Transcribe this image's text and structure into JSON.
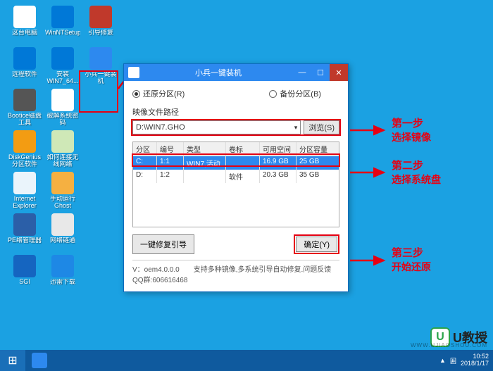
{
  "desktop_icons": {
    "col1": [
      {
        "label": "这台电脑",
        "style": "background:#fff;"
      },
      {
        "label": "远程软件",
        "style": "background:#0078d7;color:#fff;"
      },
      {
        "label": "Bootice磁盘工具",
        "style": "background:#555;"
      },
      {
        "label": "DiskGenius分区软件",
        "style": "background:#f39c12;"
      },
      {
        "label": "Internet Explorer",
        "style": "background:#eaf4fb;color:#1e6db1;"
      },
      {
        "label": "PE络管理器",
        "style": "background:#2b5fa8;"
      },
      {
        "label": "SGI",
        "style": "background:#1565c0;color:#fff;"
      }
    ],
    "col2": [
      {
        "label": "WinNTSetup",
        "style": "background:#0078d7;"
      },
      {
        "label": "安装WIN7_64...",
        "style": "background:#0078d7;color:#fff;"
      },
      {
        "label": "破解系统密码",
        "style": "background:#fff;color:#d00;"
      },
      {
        "label": "如何连接无线网络",
        "style": "background:#cfe8b7;"
      },
      {
        "label": "手动运行Ghost",
        "style": "background:#f5b041;"
      },
      {
        "label": "网络链通",
        "style": "background:#e8e8e8;"
      },
      {
        "label": "迅雷下载",
        "style": "background:#1e88e5;color:#fff;"
      }
    ],
    "col3": [
      {
        "label": "引导修复",
        "style": "background:#c0392b;color:#fff;"
      },
      {
        "label": "小兵一键装机",
        "style": "background:#2d89ef;color:#fff;"
      }
    ]
  },
  "dialog": {
    "title": "小兵一键装机",
    "radio_restore": "还原分区(R)",
    "radio_backup": "备份分区(B)",
    "path_label": "映像文件路径",
    "path_value": "D:\\WIN7.GHO",
    "browse": "浏览(S)",
    "table": {
      "headers": [
        "分区",
        "编号",
        "类型",
        "卷标",
        "可用空间",
        "分区容量"
      ],
      "rows": [
        {
          "cells": [
            "C:",
            "1:1",
            "WIN7,活动",
            "",
            "16.9 GB",
            "25 GB"
          ],
          "selected": true
        },
        {
          "cells": [
            "D:",
            "1:2",
            "",
            "软件",
            "20.3 GB",
            "35 GB"
          ],
          "selected": false
        }
      ]
    },
    "repair_btn": "一键修复引导",
    "ok_btn": "确定(Y)",
    "status": "V：oem4.0.0.0　　支持多种镜像,多系统引导自动修复.问题反馈QQ群:606616468"
  },
  "annotations": {
    "step1_title": "第一步",
    "step1_text": "选择镜像",
    "step2_title": "第二步",
    "step2_text": "选择系统盘",
    "step3_title": "第三步",
    "step3_text": "开始还原"
  },
  "taskbar": {
    "time": "10:52",
    "date": "2018/1/17"
  },
  "watermark": {
    "logo": "U",
    "text": "U教授",
    "url": "WWW.UJIAOSHOU.COM"
  }
}
